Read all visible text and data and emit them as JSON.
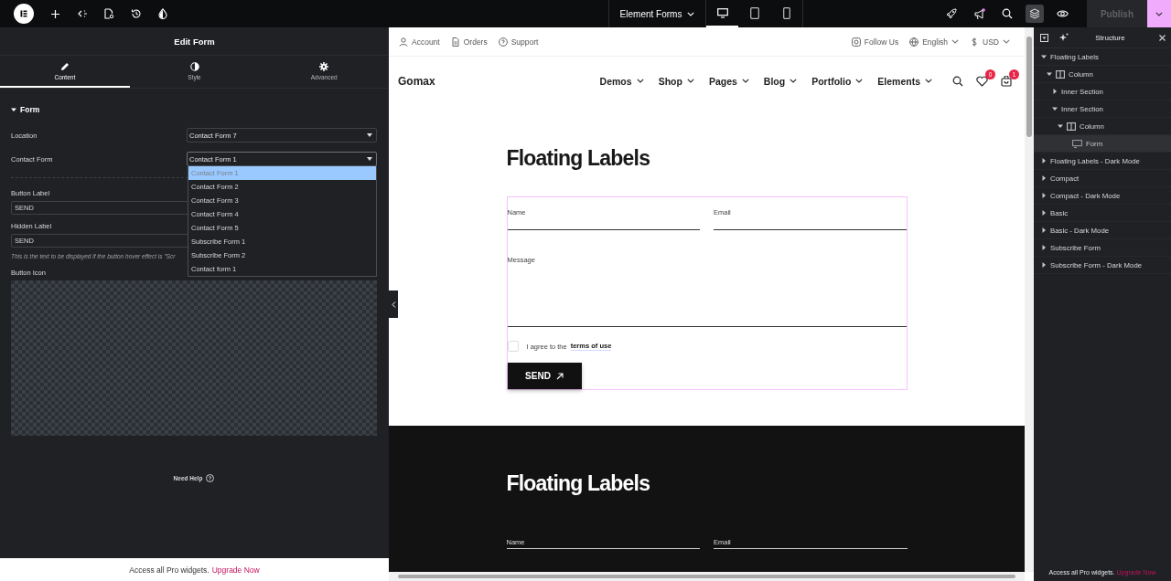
{
  "topbar": {
    "document_title": "Element Forms",
    "devices": [
      {
        "kind": "desktop",
        "selected": true
      },
      {
        "kind": "tablet",
        "selected": false
      },
      {
        "kind": "mobile",
        "selected": false
      }
    ],
    "layers_open": true,
    "publish": {
      "label": "Publish",
      "disabled": true
    }
  },
  "editor": {
    "title": "Edit Form",
    "tabs": [
      {
        "label": "Content",
        "kind": "pencil",
        "selected": true
      },
      {
        "label": "Style",
        "kind": "contrast",
        "selected": false
      },
      {
        "label": "Advanced",
        "kind": "gear",
        "selected": false
      }
    ],
    "section": {
      "title": "Form",
      "expanded": true
    },
    "location": {
      "label": "Location",
      "value": "Contact Form 7"
    },
    "contact_form": {
      "label": "Contact Form",
      "value": "Contact Form 1",
      "open": true,
      "options": [
        {
          "label": "Contact Form 1",
          "selected": true
        },
        {
          "label": "Contact Form 2",
          "selected": false
        },
        {
          "label": "Contact Form 3",
          "selected": false
        },
        {
          "label": "Contact Form 4",
          "selected": false
        },
        {
          "label": "Contact Form 5",
          "selected": false
        },
        {
          "label": "Subscribe Form 1",
          "selected": false
        },
        {
          "label": "Subscribe Form 2",
          "selected": false
        },
        {
          "label": "Contact form 1",
          "selected": false
        }
      ]
    },
    "button_label": {
      "label": "Button Label",
      "value": "SEND"
    },
    "hidden_label": {
      "label": "Hidden Label",
      "value": "SEND",
      "hint": "This is the text to be displayed if the button hover effect is \"Scr"
    },
    "button_icon": {
      "label": "Button Icon"
    },
    "help": "Need Help",
    "promo": {
      "text": "Access all Pro widgets.",
      "link": "Upgrade Now"
    }
  },
  "site": {
    "utility_left": [
      {
        "label": "Account",
        "kind": "user"
      },
      {
        "label": "Orders",
        "kind": "doc"
      },
      {
        "label": "Support",
        "kind": "help"
      }
    ],
    "utility_right": [
      {
        "label": "Follow Us",
        "kind": "instagram"
      },
      {
        "label": "English",
        "kind": "globe"
      },
      {
        "label": "USD",
        "kind": "dollar"
      }
    ],
    "brand": "Gomax",
    "nav": [
      "Demos",
      "Shop",
      "Pages",
      "Blog",
      "Portfolio",
      "Elements"
    ],
    "wishlist_count": "0",
    "cart_count": "1",
    "light_section": {
      "heading": "Floating Labels",
      "name": "Name",
      "email": "Email",
      "message": "Message",
      "agree_text": "I agree to the",
      "agree_link": "terms of use",
      "agree_checked": false,
      "submit": "SEND"
    },
    "dark_section": {
      "heading": "Floating Labels",
      "name": "Name",
      "email": "Email"
    }
  },
  "structure": {
    "title": "Structure",
    "tree": [
      {
        "label": "Floating Labels",
        "expanded": true,
        "selected": false,
        "children": [
          {
            "label": "Column",
            "kind": "column",
            "expanded": true,
            "selected": false,
            "children": [
              {
                "label": "Inner Section",
                "expanded": false,
                "selected": false
              },
              {
                "label": "Inner Section",
                "expanded": true,
                "selected": false,
                "children": [
                  {
                    "label": "Column",
                    "kind": "column",
                    "expanded": true,
                    "selected": false,
                    "children": [
                      {
                        "label": "Form",
                        "kind": "widget",
                        "selected": true
                      }
                    ]
                  }
                ]
              }
            ]
          }
        ]
      },
      {
        "label": "Floating Labels - Dark Mode",
        "expanded": false,
        "selected": false
      },
      {
        "label": "Compact",
        "expanded": false,
        "selected": false
      },
      {
        "label": "Compact - Dark Mode",
        "expanded": false,
        "selected": false
      },
      {
        "label": "Basic",
        "expanded": false,
        "selected": false
      },
      {
        "label": "Basic - Dark Mode",
        "expanded": false,
        "selected": false
      },
      {
        "label": "Subscribe Form",
        "expanded": false,
        "selected": false
      },
      {
        "label": "Subscribe Form - Dark Mode",
        "expanded": false,
        "selected": false
      }
    ],
    "promo": {
      "text": "Access all Pro widgets.",
      "link": "Upgrade Now"
    }
  }
}
